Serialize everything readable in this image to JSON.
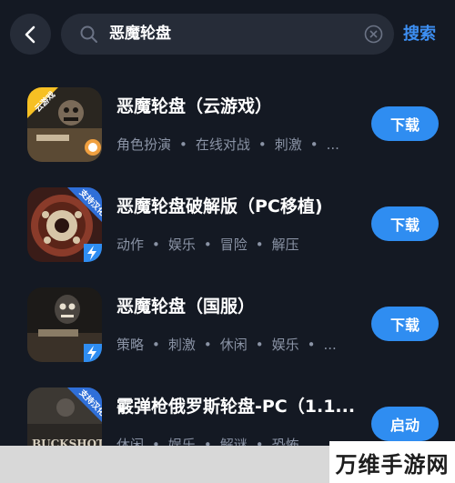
{
  "header": {
    "query": "恶魔轮盘",
    "search_label": "搜索"
  },
  "results": [
    {
      "title": "恶魔轮盘（云游戏）",
      "tags": [
        "角色扮演",
        "在线对战",
        "刺激",
        "..."
      ],
      "action": "下载",
      "badge": "云游戏"
    },
    {
      "title": "恶魔轮盘破解版（PC移植)",
      "tags": [
        "动作",
        "娱乐",
        "冒险",
        "解压"
      ],
      "action": "下载",
      "badge": "支持汉化"
    },
    {
      "title": "恶魔轮盘（国服）",
      "tags": [
        "策略",
        "刺激",
        "休闲",
        "娱乐",
        "..."
      ],
      "action": "下载",
      "badge": ""
    },
    {
      "title": "霰弹枪俄罗斯轮盘-PC（1.1...",
      "tags": [
        "休闲",
        "娱乐",
        "解谜",
        "恐怖"
      ],
      "action": "启动",
      "badge": "支持汉化",
      "thumb_text": "BUCKSHOT"
    }
  ],
  "watermark": "万维手游网",
  "colors": {
    "background": "#141923",
    "accent": "#2f8df1",
    "tag_text": "#8a93a5"
  }
}
